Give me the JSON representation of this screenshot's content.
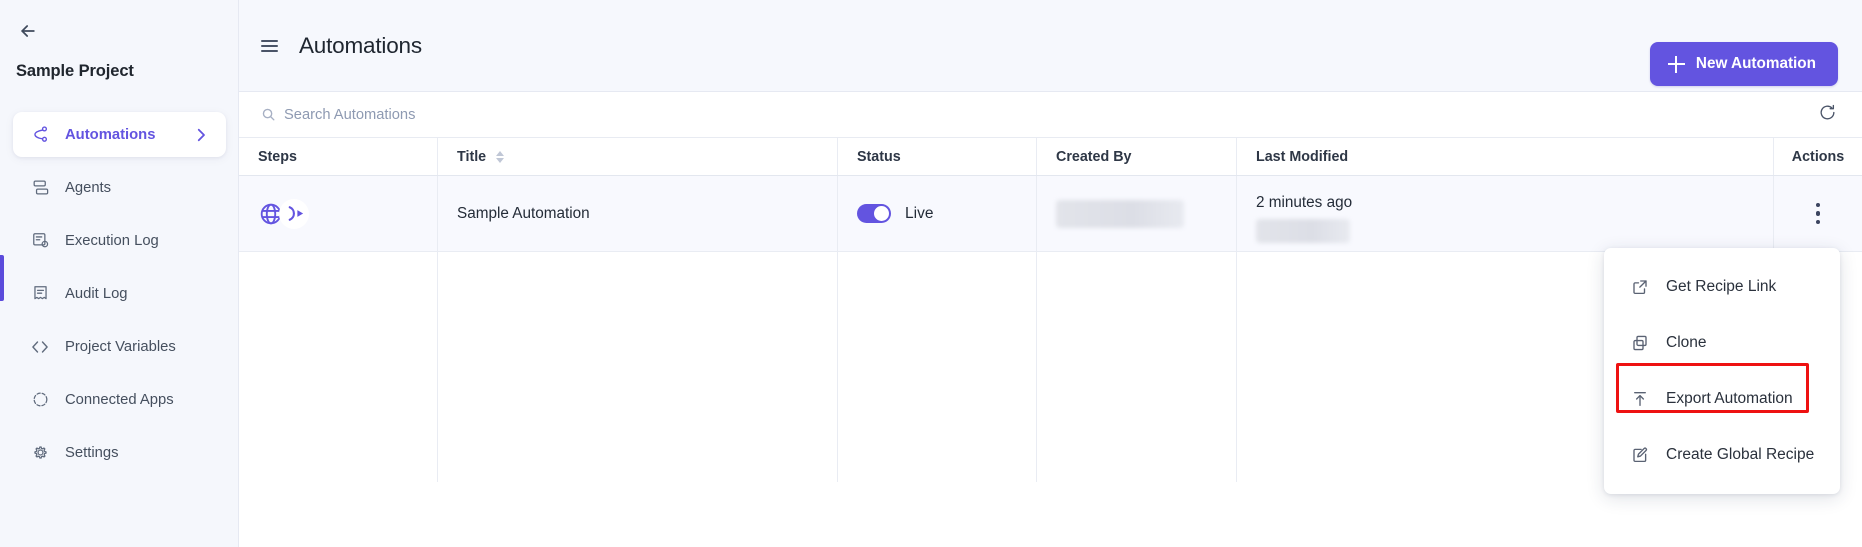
{
  "sidebar": {
    "back_icon": "arrow-left-icon",
    "project_title": "Sample Project",
    "items": [
      {
        "label": "Automations",
        "icon": "automations-icon",
        "active": true,
        "chevron": true
      },
      {
        "label": "Agents",
        "icon": "agents-icon",
        "active": false,
        "chevron": false
      },
      {
        "label": "Execution Log",
        "icon": "execution-log-icon",
        "active": false,
        "chevron": false
      },
      {
        "label": "Audit Log",
        "icon": "audit-log-icon",
        "active": false,
        "chevron": false
      },
      {
        "label": "Project Variables",
        "icon": "code-brackets-icon",
        "active": false,
        "chevron": false
      },
      {
        "label": "Connected Apps",
        "icon": "connected-apps-icon",
        "active": false,
        "chevron": false
      },
      {
        "label": "Settings",
        "icon": "gear-icon",
        "active": false,
        "chevron": false
      }
    ]
  },
  "topbar": {
    "menu_icon": "hamburger-icon",
    "title": "Automations",
    "new_button_label": "New Automation",
    "new_button_icon": "plus-icon"
  },
  "search": {
    "placeholder": "Search Automations",
    "value": "",
    "icon": "search-icon",
    "refresh_icon": "refresh-icon"
  },
  "table": {
    "columns": [
      {
        "label": "Steps",
        "sortable": false
      },
      {
        "label": "Title",
        "sortable": true
      },
      {
        "label": "Status",
        "sortable": false
      },
      {
        "label": "Created By",
        "sortable": false
      },
      {
        "label": "Last Modified",
        "sortable": false
      },
      {
        "label": "Actions",
        "sortable": false
      }
    ],
    "rows": [
      {
        "steps_icons": [
          "globe-icon",
          "connector-arrow-icon"
        ],
        "title": "Sample Automation",
        "status": {
          "enabled": true,
          "label": "Live"
        },
        "created_by": "",
        "last_modified": "2 minutes ago",
        "actions_icon": "kebab-menu-icon"
      }
    ]
  },
  "context_menu": {
    "items": [
      {
        "label": "Get Recipe Link",
        "icon": "external-link-icon",
        "highlighted": false
      },
      {
        "label": "Clone",
        "icon": "copy-icon",
        "highlighted": false
      },
      {
        "label": "Export Automation",
        "icon": "upload-icon",
        "highlighted": true
      },
      {
        "label": "Create Global Recipe",
        "icon": "edit-square-icon",
        "highlighted": false
      }
    ]
  },
  "colors": {
    "accent": "#6354e0",
    "sidebar_bg": "#f5f7fc",
    "topbar_bg": "#f6f8fd",
    "row_bg": "#f8f9fe",
    "highlight_border": "#ee1111",
    "text_primary": "#242c38",
    "text_muted": "#8e9ab2"
  }
}
